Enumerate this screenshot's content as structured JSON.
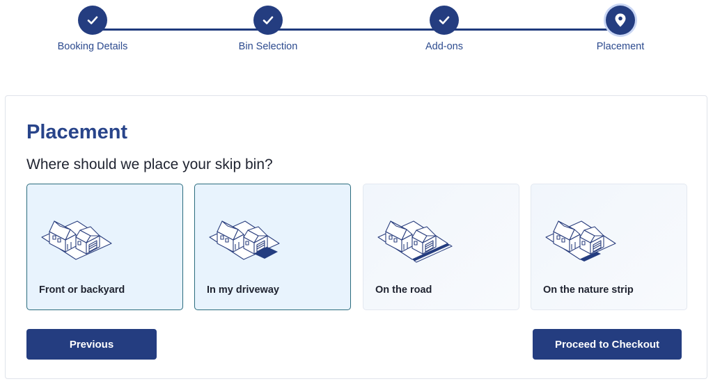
{
  "stepper": {
    "steps": [
      {
        "label": "Booking Details",
        "status": "complete",
        "icon": "check-icon"
      },
      {
        "label": "Bin Selection",
        "status": "complete",
        "icon": "check-icon"
      },
      {
        "label": "Add-ons",
        "status": "complete",
        "icon": "check-icon"
      },
      {
        "label": "Placement",
        "status": "current",
        "icon": "location-pin-icon"
      }
    ]
  },
  "main": {
    "title": "Placement",
    "question": "Where should we place your skip bin?",
    "options": [
      {
        "label": "Front or backyard",
        "selected": true,
        "icon": "house-yard-icon"
      },
      {
        "label": "In my driveway",
        "selected": true,
        "icon": "house-driveway-icon"
      },
      {
        "label": "On the road",
        "selected": false,
        "icon": "house-road-icon"
      },
      {
        "label": "On the nature strip",
        "selected": false,
        "icon": "house-nature-strip-icon"
      }
    ],
    "previous_label": "Previous",
    "checkout_label": "Proceed to Checkout"
  },
  "colors": {
    "primary": "#243d80",
    "selected_border": "#2a6b7d",
    "selected_bg": "#e8f3fd"
  }
}
